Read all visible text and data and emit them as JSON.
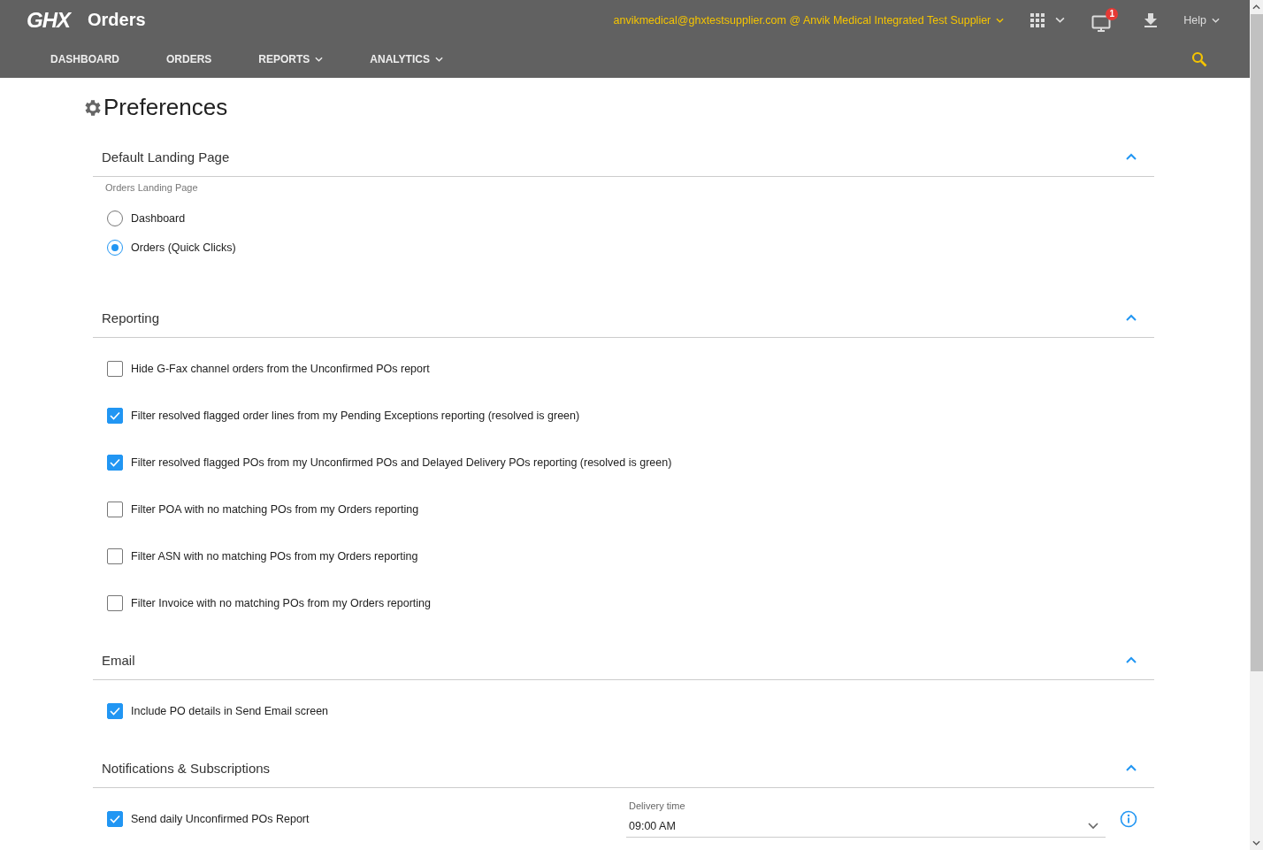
{
  "header": {
    "logo": "GHX",
    "app_title": "Orders",
    "account": "anvikmedical@ghxtestsupplier.com @ Anvik Medical Integrated Test Supplier",
    "notification_count": "1",
    "help": "Help"
  },
  "nav": [
    {
      "label": "DASHBOARD",
      "has_menu": false
    },
    {
      "label": "ORDERS",
      "has_menu": false
    },
    {
      "label": "REPORTS",
      "has_menu": true
    },
    {
      "label": "ANALYTICS",
      "has_menu": true
    }
  ],
  "page_title": "Preferences",
  "sections": [
    {
      "title": "Default Landing Page",
      "expanded": true,
      "caption": "Orders Landing Page",
      "options": [
        {
          "kind": "radio",
          "label": "Dashboard",
          "selected": false
        },
        {
          "kind": "radio",
          "label": "Orders (Quick Clicks)",
          "selected": true
        }
      ]
    },
    {
      "title": "Reporting",
      "expanded": true,
      "options": [
        {
          "kind": "checkbox",
          "label": "Hide G-Fax channel orders from the Unconfirmed POs report",
          "checked": false
        },
        {
          "kind": "checkbox",
          "label": "Filter resolved flagged order lines from my Pending Exceptions reporting (resolved is green)",
          "checked": true
        },
        {
          "kind": "checkbox",
          "label": "Filter resolved flagged POs from my Unconfirmed POs and Delayed Delivery POs reporting (resolved is green)",
          "checked": true
        },
        {
          "kind": "checkbox",
          "label": "Filter POA with no matching POs from my Orders reporting",
          "checked": false
        },
        {
          "kind": "checkbox",
          "label": "Filter ASN with no matching POs from my Orders reporting",
          "checked": false
        },
        {
          "kind": "checkbox",
          "label": "Filter Invoice with no matching POs from my Orders reporting",
          "checked": false
        }
      ]
    },
    {
      "title": "Email",
      "expanded": true,
      "options": [
        {
          "kind": "checkbox",
          "label": "Include PO details in Send Email screen",
          "checked": true
        }
      ]
    },
    {
      "title": "Notifications & Subscriptions",
      "expanded": true,
      "options": [
        {
          "kind": "checkbox",
          "label": "Send daily Unconfirmed POs Report",
          "checked": true,
          "delivery_time": {
            "label": "Delivery time",
            "value": "09:00 AM"
          }
        }
      ]
    }
  ]
}
